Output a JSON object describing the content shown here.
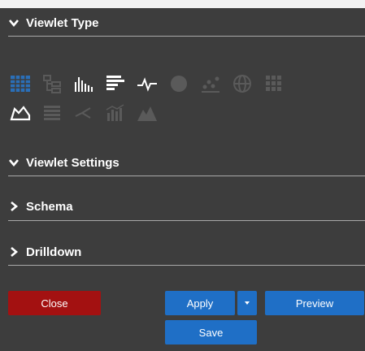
{
  "sections": {
    "viewlet_type": {
      "label": "Viewlet Type"
    },
    "viewlet_settings": {
      "label": "Viewlet Settings"
    },
    "schema": {
      "label": "Schema"
    },
    "drilldown": {
      "label": "Drilldown"
    }
  },
  "chart_type_icons": {
    "row1": [
      "grid-table-icon",
      "tree-icon",
      "bar-chart-icon",
      "horizontal-bar-icon",
      "line-chart-icon",
      "pie-chart-icon",
      "scatter-icon",
      "globe-icon",
      "heatmap-icon"
    ],
    "row2": [
      "area-chart-icon",
      "list-icon",
      "network-icon",
      "column-line-icon",
      "mountain-icon"
    ],
    "selected": "grid-table-icon"
  },
  "buttons": {
    "close": "Close",
    "apply": "Apply",
    "preview": "Preview",
    "save": "Save"
  },
  "colors": {
    "panel_bg": "#3d3d3d",
    "close_button": "#a31111",
    "primary_button": "#1f6fc6",
    "icon_dim": "#5a5a5a",
    "icon_selected": "#2a6fb8"
  }
}
